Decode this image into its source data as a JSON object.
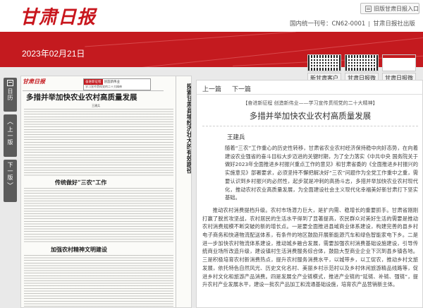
{
  "header": {
    "logo": "甘肃日报",
    "old_version_label": "旧版甘肃日报入口",
    "cn_label": "国内统一刊号：CN62-0001",
    "publisher": "甘肃日报社出版"
  },
  "banner": {
    "date": "2023年02月21日"
  },
  "toolbar": {
    "calendar": "日历",
    "prev_edition": "上一版",
    "next_edition": "下一版"
  },
  "newspaper": {
    "masthead": "甘肃日报",
    "topbox_tag1": "奋进新征程",
    "topbox_tag2": "创造新伟业",
    "topbox_sub": "学习宣传贯彻党的二十大精神",
    "title": "多措并举加快农业农村高质量发展",
    "author": "王建兵",
    "section1": "传统做好“三农”工作",
    "section2": "加强农村精神文明建设",
    "side_title": "探索甘肃县域经济壮大的有效路径"
  },
  "thumbs": [
    {
      "label": "新甘肃客户端",
      "icon": "qr-code-icon"
    },
    {
      "label": "甘肃日报微信",
      "icon": "qr-code-icon"
    },
    {
      "label": "甘肃日报微博",
      "icon": "page-icon"
    }
  ],
  "article": {
    "prev": "上一篇",
    "next": "下一篇",
    "kicker": "【奋进新征程 创造新伟业——学习宣传贯彻党的二十大精神】",
    "headline": "多措并举加快农业农村高质量发展",
    "author": "王建兵",
    "paragraphs": [
      "随着“三农”工作重心的历史性转移，甘肃省农业农村经济保持稳中向好态势，在向着建设农业强省的奋斗目标大步迈进的关键时期，为了全力落实《中共中央 国务院关于做好2023年全面推进乡村振兴重点工作的意见》和甘肃省委的《全面推进乡村振兴的实施意见》部署要求，必须坚持不懈把解决好“三农”问题作为全党工作重中之重，需要认识到乡村振兴的必然性，起步就是冲刺的高扬斗志，多措并举加快农业农村现代化，推动农村农业高质量发展，为全面建设社会主义现代化幸福美好新甘肃打下坚实基础。",
      "推动农村消费提档升级。农村市场潜力巨大，是扩内需、稳增长的重要抓手。甘肃省刚刚打赢了脱贫攻坚战，农村居民的生活水平得到了显著提高，农民群众对美好生活的需要是推动农村消费规模不断突破的新的增长点。一是要全面推进县域商业体系建设，构建完善的县乡村电子商务和快递物流配送体系，有条件的地区鼓励开展新能源汽车和绿色智能家电下乡。二是进一步加快农村物流体系建设，推动城乡融合发展，需要加强农村消费基础设施建设，引导传统商业场所改造升级，建设镇村生活消费服务综合体，鼓励大型商业企业下沉到县乡镇各地。三是积极培育农村新消费热点，提升农村服务消费水平，以城带乡，以工促农，推动乡村文旅发展，依托特色自然风光、历史文化名村、美丽乡村示范村以及乡村休闲旅游精品线路等，促进乡村文化和旅游产品消费。四是发展全产业链模式，推进产业链的“延链、补链、强链”，提升农村产业发展水平，建设一批农产品加工和流通基础设施，培育农产品营销新主体。"
    ]
  }
}
